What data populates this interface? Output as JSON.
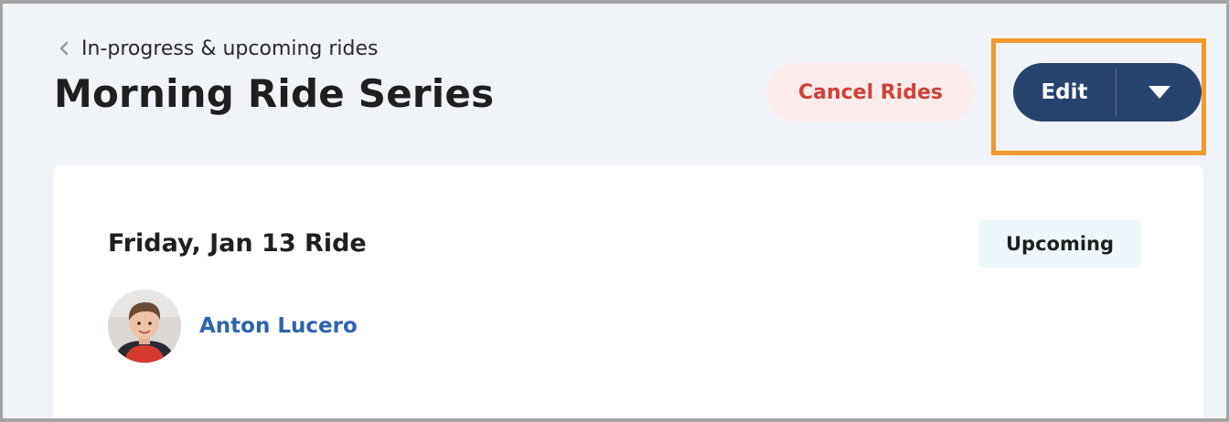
{
  "header": {
    "breadcrumb_label": "In-progress & upcoming rides",
    "page_title": "Morning Ride Series"
  },
  "actions": {
    "cancel_label": "Cancel Rides",
    "edit_label": "Edit"
  },
  "ride": {
    "title": "Friday, Jan 13 Ride",
    "status": "Upcoming",
    "rider_name": "Anton Lucero"
  },
  "colors": {
    "page_bg": "#f0f3f8",
    "primary": "#27446f",
    "danger_text": "#d1403a",
    "danger_bg": "#fbeceb",
    "link": "#2e63ad",
    "highlight": "#f39a2c",
    "badge_bg": "#eef7fc"
  },
  "icons": {
    "breadcrumb": "chevron-left-icon",
    "dropdown": "caret-down-icon"
  }
}
